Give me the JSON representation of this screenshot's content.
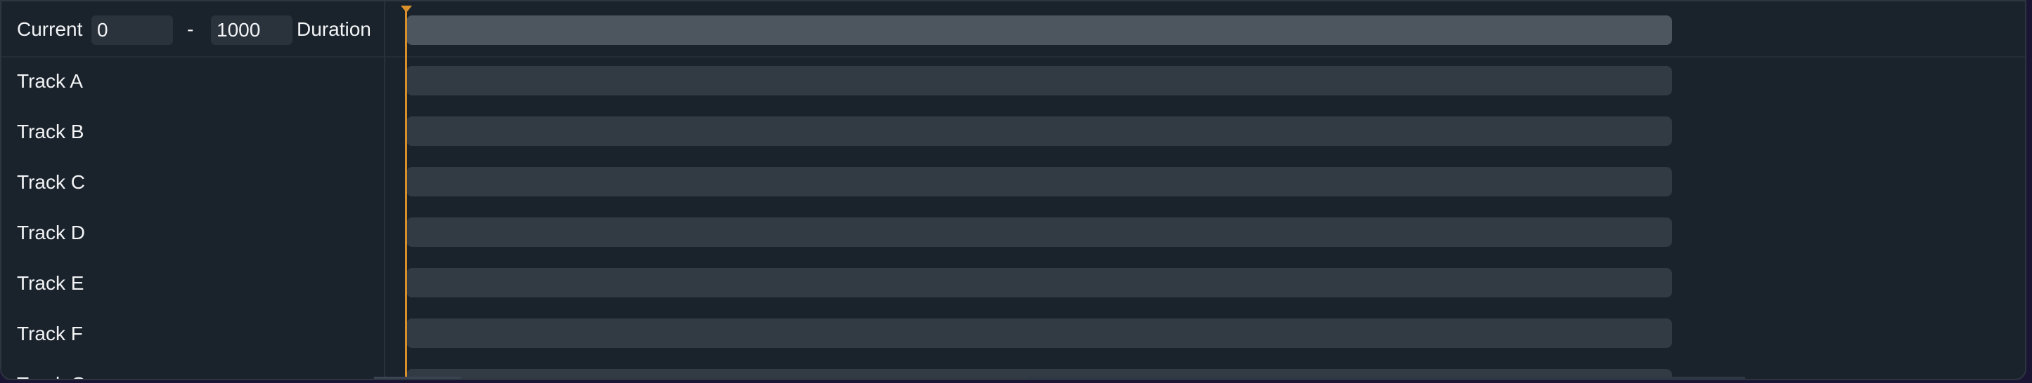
{
  "header": {
    "current_label": "Current",
    "start_value": "0",
    "separator": "-",
    "end_value": "1000",
    "duration_label": "Duration"
  },
  "tracks": [
    {
      "label": "Track A"
    },
    {
      "label": "Track B"
    },
    {
      "label": "Track C"
    },
    {
      "label": "Track D"
    },
    {
      "label": "Track E"
    },
    {
      "label": "Track F"
    },
    {
      "label": "Track G"
    }
  ],
  "playhead": {
    "value": 0
  },
  "colors": {
    "background": "#1a222b",
    "range_bar": "#4d565f",
    "track_bar": "#323a43",
    "playhead": "#d9902b",
    "text": "#f2f4f6"
  }
}
